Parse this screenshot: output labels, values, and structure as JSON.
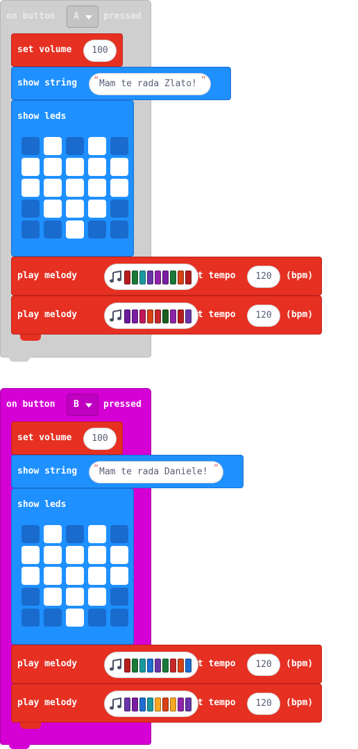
{
  "colors": {
    "event_a_bg": "#cfcfcf",
    "event_a_border": "#b8b8b8",
    "event_b_bg": "#d400d4",
    "event_b_border": "#a900a9",
    "music": "#e63022",
    "music_border": "#bf2219",
    "basic": "#1e90ff",
    "basic_border": "#1a6fd1",
    "led_on": "#ffffff",
    "led_off": "#1a6bce"
  },
  "events": [
    {
      "label_on": "on button",
      "button": "A",
      "label_pressed": "pressed",
      "volume": {
        "label": "set volume",
        "value": "100"
      },
      "show_string": {
        "label": "show string",
        "text": "Mam te rada Zlato!"
      },
      "show_leds": {
        "label": "show leds",
        "grid": [
          [
            0,
            1,
            0,
            1,
            0
          ],
          [
            1,
            1,
            1,
            1,
            1
          ],
          [
            1,
            1,
            1,
            1,
            1
          ],
          [
            0,
            1,
            1,
            1,
            0
          ],
          [
            0,
            0,
            1,
            0,
            0
          ]
        ]
      },
      "melodies": [
        {
          "label": "play melody",
          "tempo_label": "at tempo",
          "tempo": "120",
          "unit": "(bpm)",
          "notes": [
            "#b71c1c",
            "#1b7a3a",
            "#1a9aa0",
            "#6a35a8",
            "#8e24aa",
            "#7a1fa2",
            "#1b7a3a",
            "#d84315",
            "#b71c1c"
          ]
        },
        {
          "label": "play melody",
          "tempo_label": "at tempo",
          "tempo": "120",
          "unit": "(bpm)",
          "notes": [
            "#6a1b9a",
            "#7b1fa2",
            "#c2185b",
            "#d84315",
            "#c62828",
            "#1b5e20",
            "#8e24aa",
            "#b71c1c",
            "#6a35a8"
          ]
        }
      ]
    },
    {
      "label_on": "on button",
      "button": "B",
      "label_pressed": "pressed",
      "volume": {
        "label": "set volume",
        "value": "100"
      },
      "show_string": {
        "label": "show string",
        "text": "Mam te rada Daniele!"
      },
      "show_leds": {
        "label": "show leds",
        "grid": [
          [
            0,
            1,
            0,
            1,
            0
          ],
          [
            1,
            1,
            1,
            1,
            1
          ],
          [
            1,
            1,
            1,
            1,
            1
          ],
          [
            0,
            1,
            1,
            1,
            0
          ],
          [
            0,
            0,
            1,
            0,
            0
          ]
        ]
      },
      "melodies": [
        {
          "label": "play melody",
          "tempo_label": "at tempo",
          "tempo": "120",
          "unit": "(bpm)",
          "notes": [
            "#b71c1c",
            "#1b7a3a",
            "#1a9aa0",
            "#1e6fd1",
            "#6a35a8",
            "#1b7a3a",
            "#c62828",
            "#d84315",
            "#1e6fd1"
          ]
        },
        {
          "label": "play melody",
          "tempo_label": "at tempo",
          "tempo": "120",
          "unit": "(bpm)",
          "notes": [
            "#6a35a8",
            "#7b1fa2",
            "#1e6fd1",
            "#1a9aa0",
            "#f9a825",
            "#d84315",
            "#f9a825",
            "#8e24aa",
            "#6a35a8"
          ]
        }
      ]
    }
  ]
}
